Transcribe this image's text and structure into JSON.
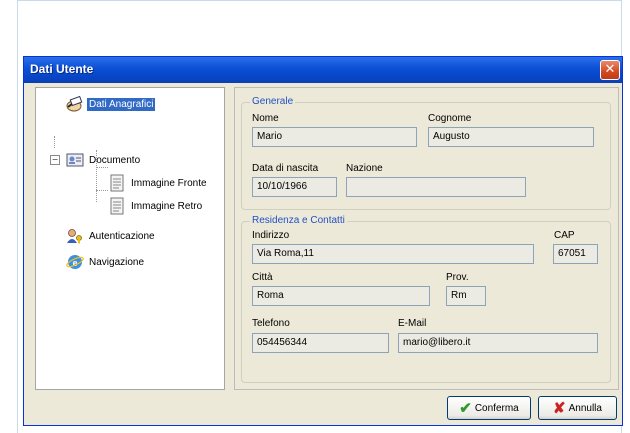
{
  "window": {
    "title": "Dati Utente",
    "close_glyph": "✕"
  },
  "tree": {
    "items": [
      {
        "label": "Dati Anagrafici",
        "icon": "hand-card-icon",
        "selected": true
      },
      {
        "label": "Documento",
        "icon": "id-card-icon",
        "expander": "−"
      },
      {
        "label": "Immagine Fronte",
        "icon": "document-icon"
      },
      {
        "label": "Immagine Retro",
        "icon": "document-icon"
      },
      {
        "label": "Autenticazione",
        "icon": "users-key-icon"
      },
      {
        "label": "Navigazione",
        "icon": "ie-globe-icon"
      }
    ]
  },
  "generale": {
    "title": "Generale",
    "nome_label": "Nome",
    "nome_value": "Mario",
    "cognome_label": "Cognome",
    "cognome_value": "Augusto",
    "nascita_label": "Data di nascita",
    "nascita_value": "10/10/1966",
    "nazione_label": "Nazione",
    "nazione_value": ""
  },
  "residenza": {
    "title": "Residenza e Contatti",
    "indirizzo_label": "Indirizzo",
    "indirizzo_value": "Via Roma,11",
    "cap_label": "CAP",
    "cap_value": "67051",
    "citta_label": "Città",
    "citta_value": "Roma",
    "prov_label": "Prov.",
    "prov_value": "Rm",
    "telefono_label": "Telefono",
    "telefono_value": "054456344",
    "email_label": "E-Mail",
    "email_value": "mario@libero.it"
  },
  "buttons": {
    "confirm_label": "Conferma",
    "confirm_glyph": "✔",
    "cancel_label": "Annulla",
    "cancel_glyph": "✘"
  },
  "colors": {
    "accent": "#316ac5",
    "titlebar": "#0a4fd6",
    "group_title": "#2251c3",
    "confirm": "#2e9a2e",
    "cancel": "#cc2222"
  }
}
